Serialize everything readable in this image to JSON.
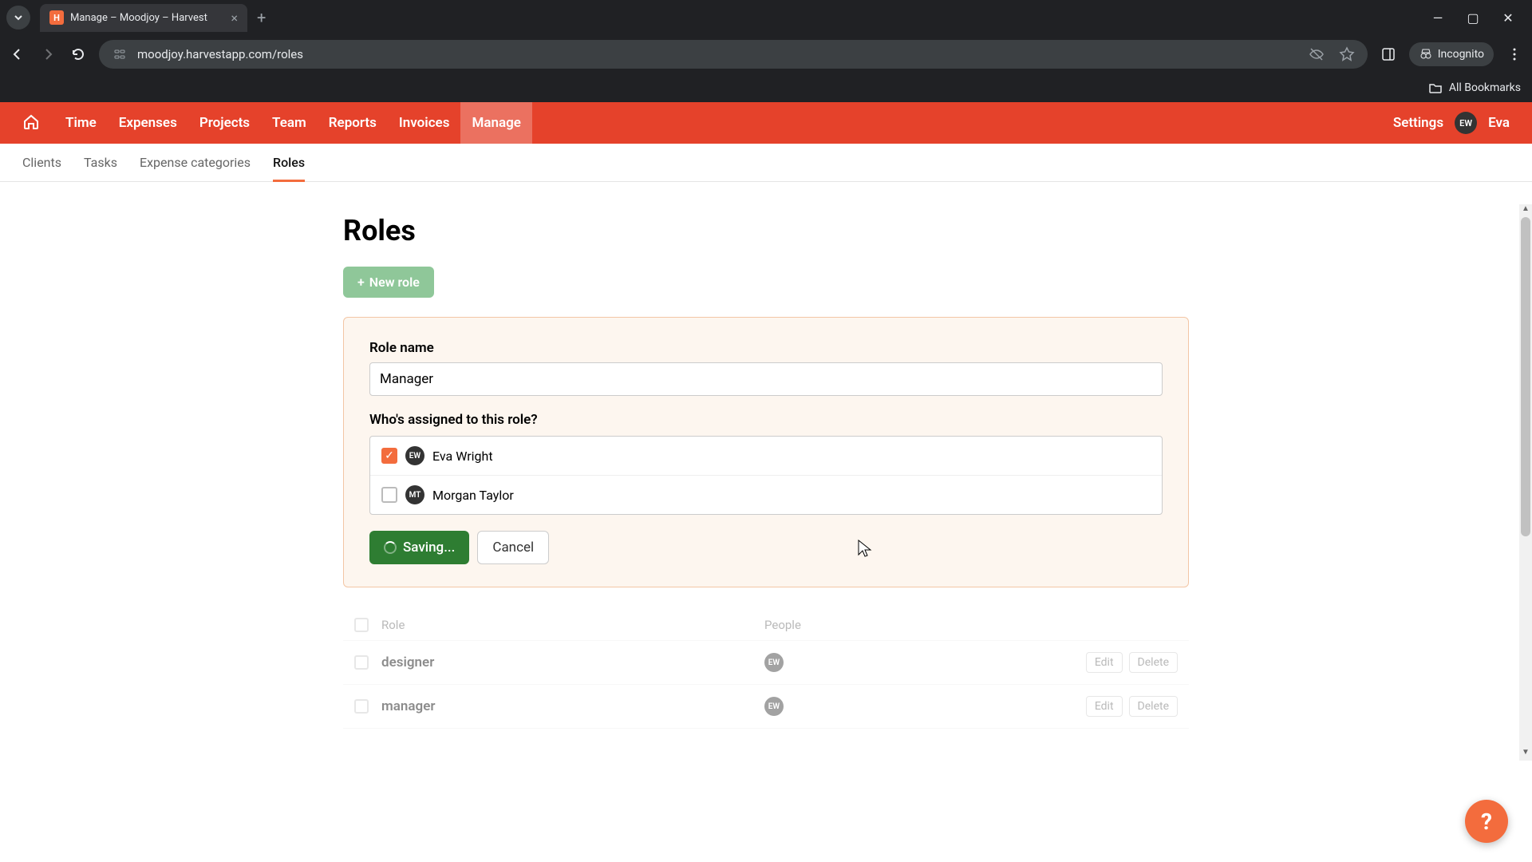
{
  "browser": {
    "tab_title": "Manage – Moodjoy – Harvest",
    "url": "moodjoy.harvestapp.com/roles",
    "incognito_label": "Incognito",
    "all_bookmarks": "All Bookmarks"
  },
  "nav": {
    "items": [
      "Time",
      "Expenses",
      "Projects",
      "Team",
      "Reports",
      "Invoices",
      "Manage"
    ],
    "active": "Manage",
    "settings": "Settings",
    "user_initials": "EW",
    "user_name": "Eva"
  },
  "subnav": {
    "items": [
      "Clients",
      "Tasks",
      "Expense categories",
      "Roles"
    ],
    "active": "Roles"
  },
  "page": {
    "title": "Roles",
    "new_role_label": "New role"
  },
  "form": {
    "role_name_label": "Role name",
    "role_name_value": "Manager",
    "assigned_label": "Who's assigned to this role?",
    "people": [
      {
        "initials": "EW",
        "name": "Eva Wright",
        "checked": true
      },
      {
        "initials": "MT",
        "name": "Morgan Taylor",
        "checked": false
      }
    ],
    "save_label": "Saving...",
    "cancel_label": "Cancel"
  },
  "table": {
    "col_role": "Role",
    "col_people": "People",
    "edit_label": "Edit",
    "delete_label": "Delete",
    "rows": [
      {
        "role": "designer",
        "people_initials": "EW"
      },
      {
        "role": "manager",
        "people_initials": "EW"
      }
    ]
  },
  "help": "?"
}
